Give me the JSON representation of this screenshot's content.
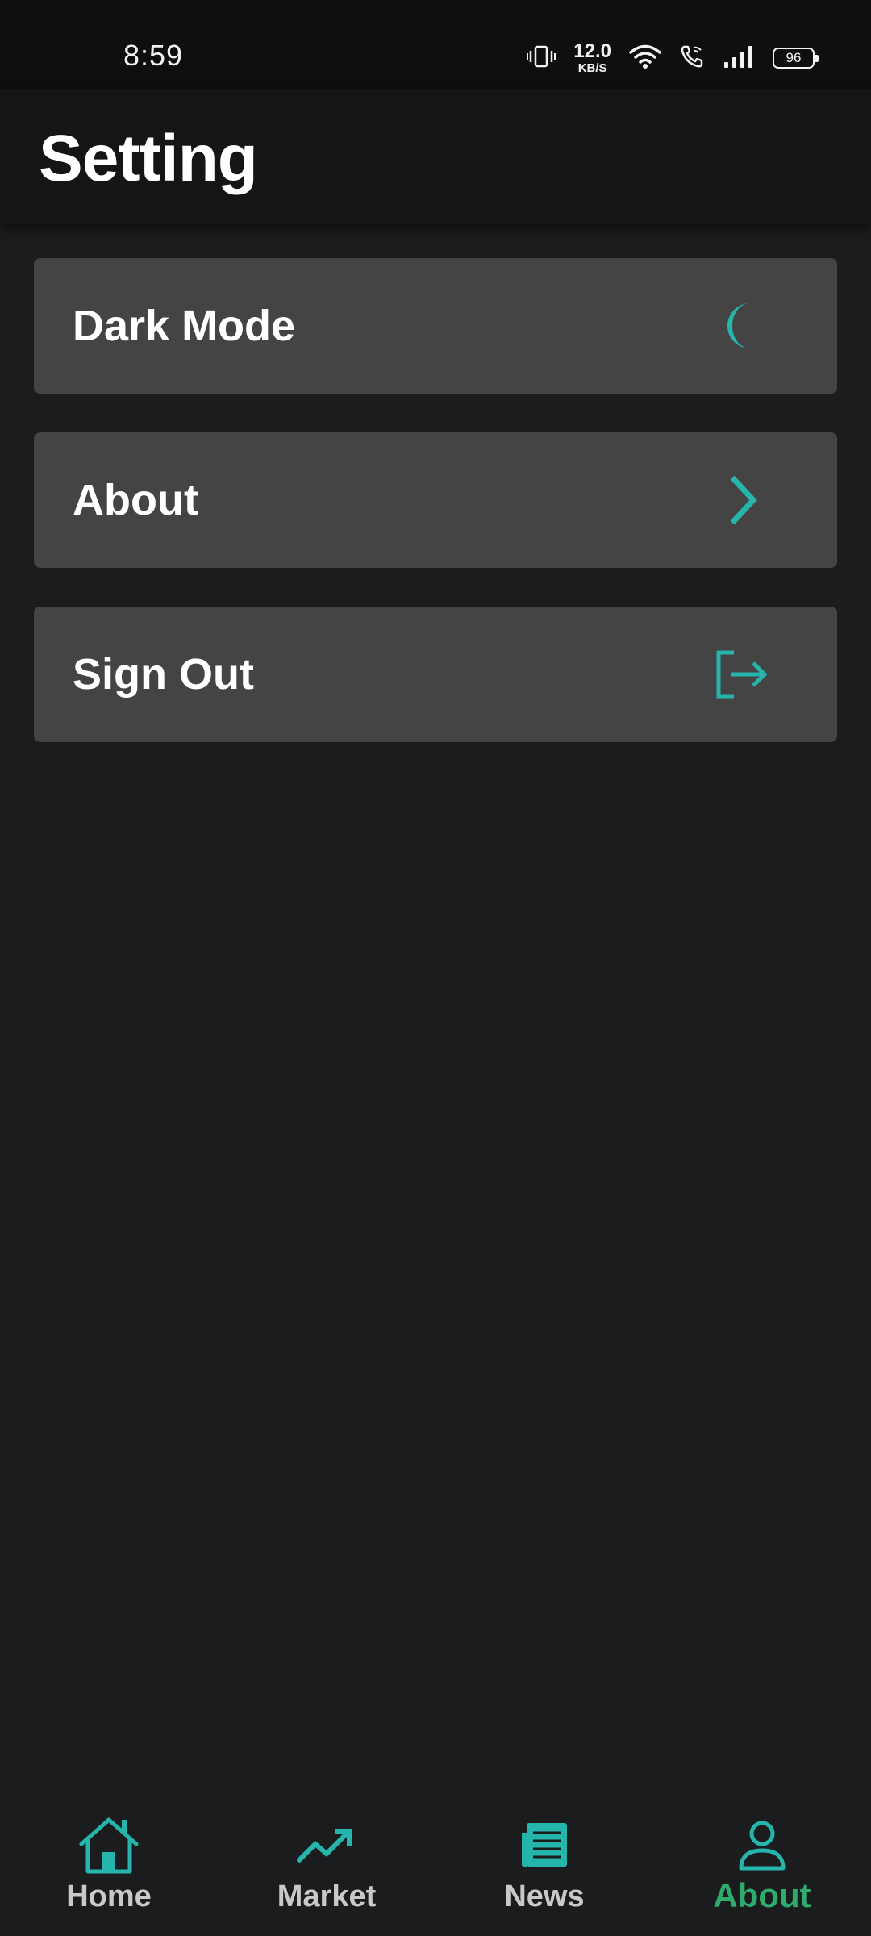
{
  "status_bar": {
    "time": "8:59",
    "net_speed_value": "12.0",
    "net_speed_unit": "KB/S",
    "battery": "96"
  },
  "header": {
    "title": "Setting"
  },
  "settings": {
    "items": [
      {
        "label": "Dark Mode",
        "icon": "moon-icon"
      },
      {
        "label": "About",
        "icon": "chevron-right-icon"
      },
      {
        "label": "Sign Out",
        "icon": "sign-out-icon"
      }
    ]
  },
  "bottom_nav": {
    "items": [
      {
        "label": "Home",
        "icon": "home-icon"
      },
      {
        "label": "Market",
        "icon": "trending-up-icon"
      },
      {
        "label": "News",
        "icon": "newspaper-icon"
      },
      {
        "label": "About",
        "icon": "user-icon",
        "active": true
      }
    ]
  },
  "colors": {
    "accent": "#26b5ad",
    "active_nav": "#2dac6e",
    "background": "#1b1c1e",
    "card": "#444444",
    "header": "#141516"
  }
}
